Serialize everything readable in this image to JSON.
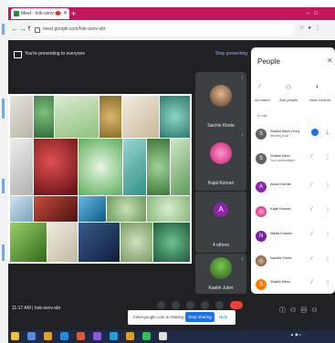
{
  "browser": {
    "tab_title": "Meet - hok-sxnv-sbr",
    "new_tab": "+",
    "url": "meet.google.com/hok-sxnv-sbr"
  },
  "presenting": {
    "message": "You're presenting to everyone",
    "stop_label": "Stop presenting"
  },
  "tiles": [
    {
      "name": "Sachin Kinde",
      "color": "#3c4043"
    },
    {
      "name": "Kajal Kumari",
      "color": "#3c4043"
    },
    {
      "name": "4 others",
      "initial": "A"
    },
    {
      "name": "Kaelin Juliet",
      "color": "#3c4043"
    }
  ],
  "people_panel": {
    "title": "People",
    "actions": [
      "All muted",
      "Add people",
      "Host controls"
    ],
    "section": "In call",
    "participants": [
      {
        "name": "Shalini Bera (You)",
        "sub": "Meeting host",
        "initial": "S",
        "color": "#5f6368"
      },
      {
        "name": "Shalini Bera",
        "sub": "Your presentation",
        "initial": "S",
        "color": "#5f6368"
      },
      {
        "name": "Asha Kumari",
        "sub": "",
        "initial": "A",
        "color": "#8e24aa"
      },
      {
        "name": "Kajal Kumari",
        "sub": "",
        "initial": "",
        "color": "#d81b60"
      },
      {
        "name": "Nikita Kumari",
        "sub": "",
        "initial": "N",
        "color": "#7b1fa2"
      },
      {
        "name": "Sachin Kinde",
        "sub": "",
        "initial": "",
        "color": "#6d4c41"
      },
      {
        "name": "Shalini Bera",
        "sub": "",
        "initial": "S",
        "color": "#f57c00"
      }
    ]
  },
  "meeting_bar": {
    "time_code": "11:17 AM | hok-sxnv-sbr",
    "share_message": "meet.google.com is sharing a window.",
    "stop_sharing": "Stop sharing",
    "hide": "Hide"
  },
  "colors": {
    "accent": "#1a73e8",
    "tabbar": "#c2185b",
    "meet_bg": "#202124"
  }
}
